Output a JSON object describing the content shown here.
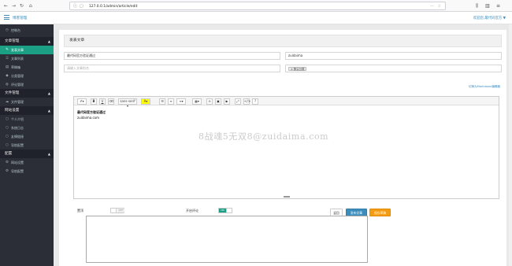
{
  "browser": {
    "url": "127.0.0.1/admin/article/edit"
  },
  "header": {
    "title": "博客管理",
    "welcome": "欢迎您,最代码官方 ▼"
  },
  "sidebar": {
    "top": [
      {
        "label": "控制台",
        "icon": "dashboard-icon"
      }
    ],
    "groups": [
      {
        "title": "文章管理",
        "items": [
          {
            "label": "发表文章",
            "icon": "edit-icon",
            "active": true
          },
          {
            "label": "文章列表",
            "icon": "list-icon"
          },
          {
            "label": "草稿箱",
            "icon": "file-icon"
          },
          {
            "label": "分类管理",
            "icon": "tag-icon"
          },
          {
            "label": "评论管理",
            "icon": "comment-icon"
          }
        ]
      },
      {
        "title": "文件管理",
        "items": [
          {
            "label": "文件管理",
            "icon": "cloud-icon"
          }
        ]
      },
      {
        "title": "网站设置",
        "items": [
          {
            "label": "个人介绍",
            "icon": "user-icon"
          },
          {
            "label": "系统日志",
            "icon": "log-icon"
          },
          {
            "label": "友情链接",
            "icon": "link-icon"
          },
          {
            "label": "导航配置",
            "icon": "nav-icon"
          }
        ]
      },
      {
        "title": "配置",
        "items": [
          {
            "label": "网站设置",
            "icon": "gear-icon"
          },
          {
            "label": "导航配置",
            "icon": "gear-icon"
          }
        ]
      }
    ]
  },
  "form": {
    "heading": "发表文章",
    "title_value": "最代码官方验证通过",
    "tags_value": "zuidaima",
    "url_placeholder": "请输入文章别名",
    "category_tag": "× 默认分类",
    "markdown_link": "切换为Markdown编辑器",
    "toolbar": {
      "font": "sans-serif ▾"
    },
    "content_line1": "最代码官方验证通过",
    "content_line2": "zuidaima.com",
    "watermark": "8战魂5无双8@zuidaima.com"
  },
  "options": {
    "top_label": "置顶",
    "top_state": "OFF",
    "comment_label": "开启评论",
    "comment_state": "ON",
    "back_button": "返回",
    "publish_button": "发布文章",
    "draft_button": "保存草稿"
  },
  "colors": {
    "accent": "#3c8dbc",
    "sidebar_bg": "#2b2e37",
    "active": "#1ca085",
    "publish": "#3c8dbc",
    "draft": "#f39c12"
  }
}
